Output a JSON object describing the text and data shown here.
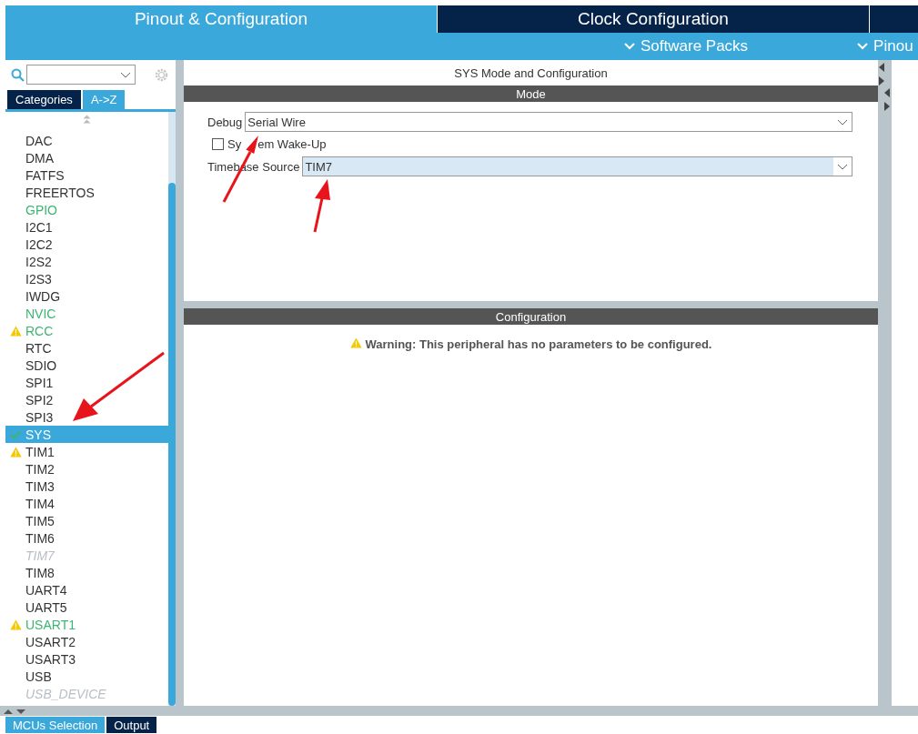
{
  "top_tabs": [
    {
      "label": "Pinout & Configuration",
      "selected": true
    },
    {
      "label": "Clock Configuration",
      "selected": false
    },
    {
      "selected": false
    }
  ],
  "sub_menus": [
    {
      "label": "Software Packs"
    },
    {
      "label": "Pinou"
    }
  ],
  "sidebar": {
    "view_tabs": [
      {
        "label": "Categories",
        "selected": false
      },
      {
        "label": "A->Z",
        "selected": true
      }
    ],
    "items": [
      {
        "label": "DAC",
        "configured": false,
        "disabled": false,
        "warning": false,
        "checked": false,
        "selected": false
      },
      {
        "label": "DMA",
        "configured": false,
        "disabled": false,
        "warning": false,
        "checked": false,
        "selected": false
      },
      {
        "label": "FATFS",
        "configured": false,
        "disabled": false,
        "warning": false,
        "checked": false,
        "selected": false
      },
      {
        "label": "FREERTOS",
        "configured": false,
        "disabled": false,
        "warning": false,
        "checked": false,
        "selected": false
      },
      {
        "label": "GPIO",
        "configured": true,
        "disabled": false,
        "warning": false,
        "checked": false,
        "selected": false
      },
      {
        "label": "I2C1",
        "configured": false,
        "disabled": false,
        "warning": false,
        "checked": false,
        "selected": false
      },
      {
        "label": "I2C2",
        "configured": false,
        "disabled": false,
        "warning": false,
        "checked": false,
        "selected": false
      },
      {
        "label": "I2S2",
        "configured": false,
        "disabled": false,
        "warning": false,
        "checked": false,
        "selected": false
      },
      {
        "label": "I2S3",
        "configured": false,
        "disabled": false,
        "warning": false,
        "checked": false,
        "selected": false
      },
      {
        "label": "IWDG",
        "configured": false,
        "disabled": false,
        "warning": false,
        "checked": false,
        "selected": false
      },
      {
        "label": "NVIC",
        "configured": true,
        "disabled": false,
        "warning": false,
        "checked": false,
        "selected": false
      },
      {
        "label": "RCC",
        "configured": true,
        "disabled": false,
        "warning": true,
        "checked": false,
        "selected": false
      },
      {
        "label": "RTC",
        "configured": false,
        "disabled": false,
        "warning": false,
        "checked": false,
        "selected": false
      },
      {
        "label": "SDIO",
        "configured": false,
        "disabled": false,
        "warning": false,
        "checked": false,
        "selected": false
      },
      {
        "label": "SPI1",
        "configured": false,
        "disabled": false,
        "warning": false,
        "checked": false,
        "selected": false
      },
      {
        "label": "SPI2",
        "configured": false,
        "disabled": false,
        "warning": false,
        "checked": false,
        "selected": false
      },
      {
        "label": "SPI3",
        "configured": false,
        "disabled": false,
        "warning": false,
        "checked": false,
        "selected": false
      },
      {
        "label": "SYS",
        "configured": false,
        "disabled": false,
        "warning": false,
        "checked": true,
        "selected": true
      },
      {
        "label": "TIM1",
        "configured": false,
        "disabled": false,
        "warning": true,
        "checked": false,
        "selected": false
      },
      {
        "label": "TIM2",
        "configured": false,
        "disabled": false,
        "warning": false,
        "checked": false,
        "selected": false
      },
      {
        "label": "TIM3",
        "configured": false,
        "disabled": false,
        "warning": false,
        "checked": false,
        "selected": false
      },
      {
        "label": "TIM4",
        "configured": false,
        "disabled": false,
        "warning": false,
        "checked": false,
        "selected": false
      },
      {
        "label": "TIM5",
        "configured": false,
        "disabled": false,
        "warning": false,
        "checked": false,
        "selected": false
      },
      {
        "label": "TIM6",
        "configured": false,
        "disabled": false,
        "warning": false,
        "checked": false,
        "selected": false
      },
      {
        "label": "TIM7",
        "configured": false,
        "disabled": true,
        "warning": false,
        "checked": false,
        "selected": false
      },
      {
        "label": "TIM8",
        "configured": false,
        "disabled": false,
        "warning": false,
        "checked": false,
        "selected": false
      },
      {
        "label": "UART4",
        "configured": false,
        "disabled": false,
        "warning": false,
        "checked": false,
        "selected": false
      },
      {
        "label": "UART5",
        "configured": false,
        "disabled": false,
        "warning": false,
        "checked": false,
        "selected": false
      },
      {
        "label": "USART1",
        "configured": true,
        "disabled": false,
        "warning": true,
        "checked": false,
        "selected": false
      },
      {
        "label": "USART2",
        "configured": false,
        "disabled": false,
        "warning": false,
        "checked": false,
        "selected": false
      },
      {
        "label": "USART3",
        "configured": false,
        "disabled": false,
        "warning": false,
        "checked": false,
        "selected": false
      },
      {
        "label": "USB",
        "configured": false,
        "disabled": false,
        "warning": false,
        "checked": false,
        "selected": false
      },
      {
        "label": "USB_DEVICE",
        "configured": false,
        "disabled": true,
        "warning": false,
        "checked": false,
        "selected": false
      }
    ]
  },
  "bottom_tabs": [
    {
      "label": "MCUs Selection",
      "selected": true
    },
    {
      "label": "Output",
      "selected": false
    }
  ],
  "panel": {
    "title": "SYS Mode and Configuration",
    "mode": {
      "header": "Mode",
      "debug": {
        "label": "Debug",
        "value": "Serial Wire",
        "highlighted": false
      },
      "wake_up": {
        "label_start": "Sy",
        "label_end": "em Wake-Up",
        "checked": false
      },
      "timebase": {
        "label": "Timebase Source",
        "value": "TIM7",
        "highlighted": true
      }
    },
    "configuration": {
      "header": "Configuration",
      "warning": "Warning: This peripheral has no parameters to be configured."
    }
  }
}
